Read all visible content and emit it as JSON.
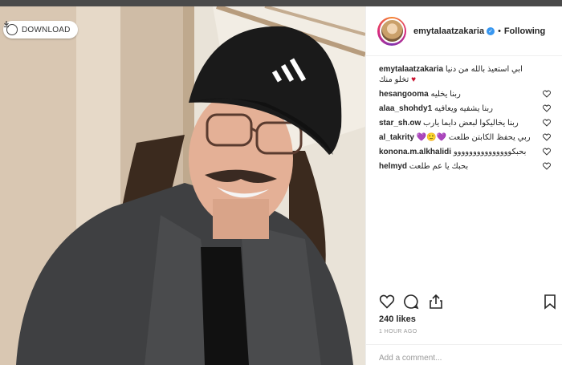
{
  "toolbar": {
    "download_label": "DOWNLOAD"
  },
  "post": {
    "author": "emytalaatzakaria",
    "follow_status": "Following",
    "separator": "•",
    "caption_user": "emytalaatzakaria",
    "caption_text": "ابي استعيذ بالله من دنيا تخلو منك",
    "comments": [
      {
        "user": "hesangooma",
        "text": "ربنا يخليه"
      },
      {
        "user": "alaa_shohdy1",
        "text": "ربنا يشفيه ويعافيه"
      },
      {
        "user": "star_sh.ow",
        "text": "ربنا يخاليكوا لبعض دايما يارب"
      },
      {
        "user": "al_takrity",
        "text": "ربي يحفظ الكابتن طلعت 💜🙂💜"
      },
      {
        "user": "konona.m.alkhalidi",
        "text": "بحبكووووووووووووووو"
      },
      {
        "user": "helmyd",
        "text": "بحبك يا عم طلعت"
      }
    ],
    "likes": "240 likes",
    "time_ago": "1 HOUR AGO",
    "add_comment_placeholder": "Add a comment..."
  },
  "icons": {
    "download": "download-icon",
    "verified": "verified-badge-icon",
    "like": "heart-outline-icon",
    "comment": "comment-bubble-icon",
    "share": "share-icon",
    "save": "bookmark-icon",
    "comment_like": "heart-outline-icon"
  },
  "colors": {
    "text": "#262626",
    "muted": "#999999",
    "verified": "#3897f0",
    "caption_heart": "#c8102e"
  }
}
